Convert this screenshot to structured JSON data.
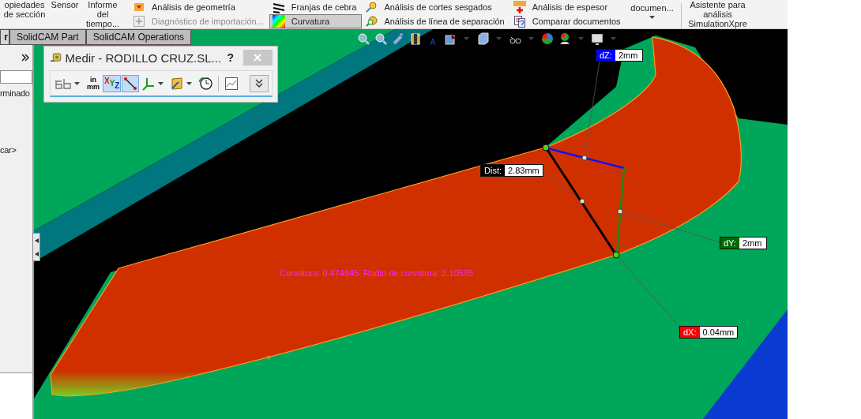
{
  "ribbon": {
    "groups": [
      {
        "kind": "large",
        "lines": [
          "opiedades",
          "de sección"
        ]
      },
      {
        "kind": "large",
        "lines": [
          "Sensor"
        ]
      },
      {
        "kind": "large",
        "lines": [
          "Informe",
          "del",
          "tiempo..."
        ]
      },
      {
        "kind": "stack",
        "items": [
          {
            "label": "Análisis de geometría",
            "disabled": false,
            "selected": false
          },
          {
            "label": "Diagnóstico de importación...",
            "disabled": true,
            "selected": false
          }
        ]
      },
      {
        "kind": "stack",
        "items": [
          {
            "label": "Franjas de cebra",
            "disabled": false,
            "selected": false
          },
          {
            "label": "Curvatura",
            "disabled": false,
            "selected": true
          }
        ]
      },
      {
        "kind": "stack",
        "items": [
          {
            "label": "Análisis de cortes sesgados",
            "disabled": false,
            "selected": false
          },
          {
            "label": "Análisis de línea de separación",
            "disabled": false,
            "selected": false
          }
        ]
      },
      {
        "kind": "stack",
        "items": [
          {
            "label": "Análisis de espesor",
            "disabled": false,
            "selected": false
          },
          {
            "label": "Comparar documentos",
            "disabled": false,
            "selected": false
          }
        ]
      },
      {
        "kind": "dropdown",
        "lines": [
          "documen..."
        ]
      },
      {
        "kind": "large",
        "lines": [
          "Asistente para",
          "análisis",
          "SimulationXpre"
        ]
      }
    ]
  },
  "tabs": [
    {
      "label": "r",
      "selected": true
    },
    {
      "label": "SolidCAM Part",
      "selected": false
    },
    {
      "label": "SolidCAM Operations",
      "selected": false
    }
  ],
  "side_panel": {
    "texts": [
      "rminado",
      "car>"
    ]
  },
  "measure_dialog": {
    "title": "Medir - RODILLO CRUZ.SL...",
    "help": "?",
    "units": [
      "in",
      "mm"
    ],
    "tools": [
      {
        "kind": "arc",
        "selected": false
      },
      {
        "kind": "units",
        "selected": false
      },
      {
        "kind": "xyz",
        "selected": true
      },
      {
        "kind": "point",
        "selected": true
      },
      {
        "kind": "axes",
        "selected": false
      },
      {
        "kind": "projection",
        "selected": false
      },
      {
        "kind": "history",
        "selected": false
      },
      {
        "kind": "sensor",
        "selected": false
      }
    ],
    "xyz": [
      "X",
      "Y",
      "Z"
    ]
  },
  "curvature_readout": [
    "Curvatura: 0.474845",
    "Radio de curvatura: 2.10595"
  ],
  "measurements": [
    {
      "label": "dZ:",
      "value": "2mm",
      "color": "#0000ff"
    },
    {
      "label": "Dist:",
      "value": "2.83mm",
      "color": "#000000"
    },
    {
      "label": "dY:",
      "value": "2mm",
      "color": "#006a00"
    },
    {
      "label": "dX:",
      "value": "0.04mm",
      "color": "#ff0000"
    }
  ]
}
